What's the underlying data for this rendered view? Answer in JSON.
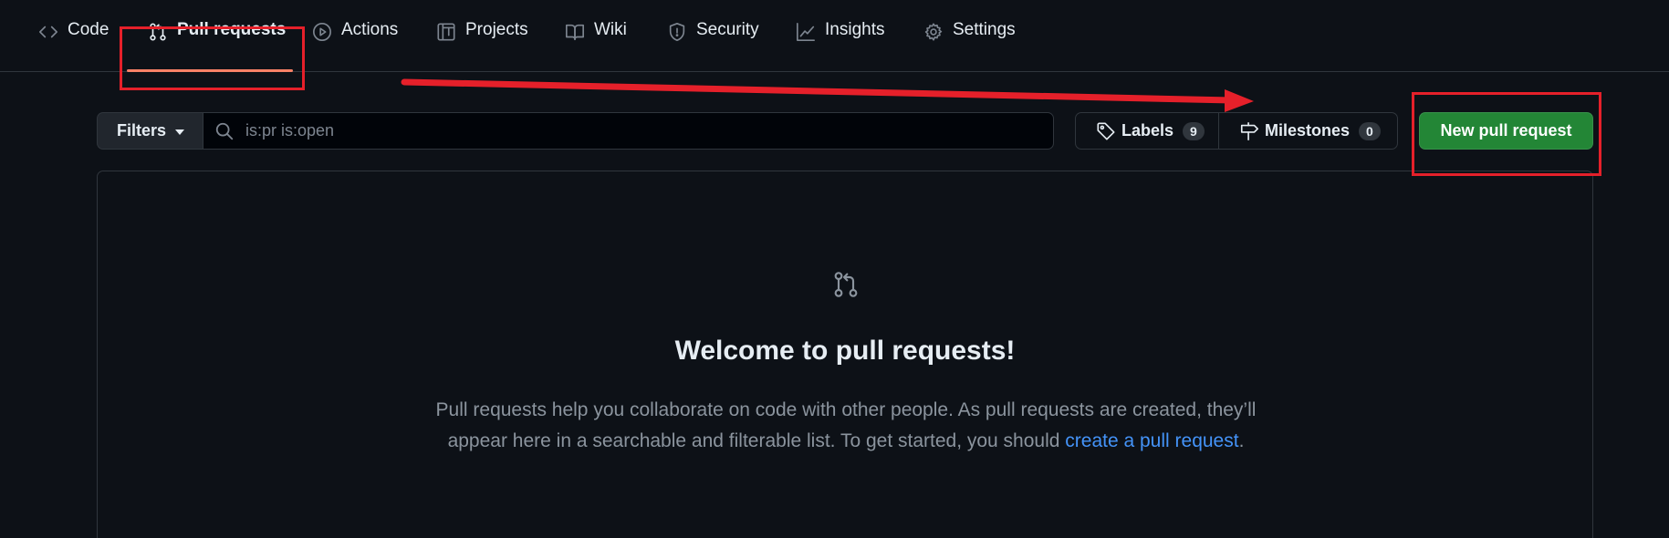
{
  "nav": {
    "tabs": [
      {
        "label": "Code",
        "icon": "code-icon"
      },
      {
        "label": "Pull requests",
        "icon": "git-pull-request-icon",
        "active": true
      },
      {
        "label": "Actions",
        "icon": "play-icon"
      },
      {
        "label": "Projects",
        "icon": "table-icon"
      },
      {
        "label": "Wiki",
        "icon": "book-icon"
      },
      {
        "label": "Security",
        "icon": "shield-icon"
      },
      {
        "label": "Insights",
        "icon": "graph-icon"
      },
      {
        "label": "Settings",
        "icon": "gear-icon"
      }
    ]
  },
  "toolbar": {
    "filters_label": "Filters",
    "search_placeholder": "is:pr is:open",
    "labels_label": "Labels",
    "labels_count": "9",
    "milestones_label": "Milestones",
    "milestones_count": "0",
    "new_pr_label": "New pull request"
  },
  "blankslate": {
    "title": "Welcome to pull requests!",
    "desc_line1": "Pull requests help you collaborate on code with other people. As pull requests are created, they’ll",
    "desc_line2": "appear here in a searchable and filterable list. To get started, you should",
    "link": "create a pull request",
    "desc_end": "."
  },
  "colors": {
    "background": "#0d1117",
    "accent_underline": "#f78166",
    "primary_button": "#238636",
    "link": "#4493f8",
    "annotation": "#e5202a"
  }
}
